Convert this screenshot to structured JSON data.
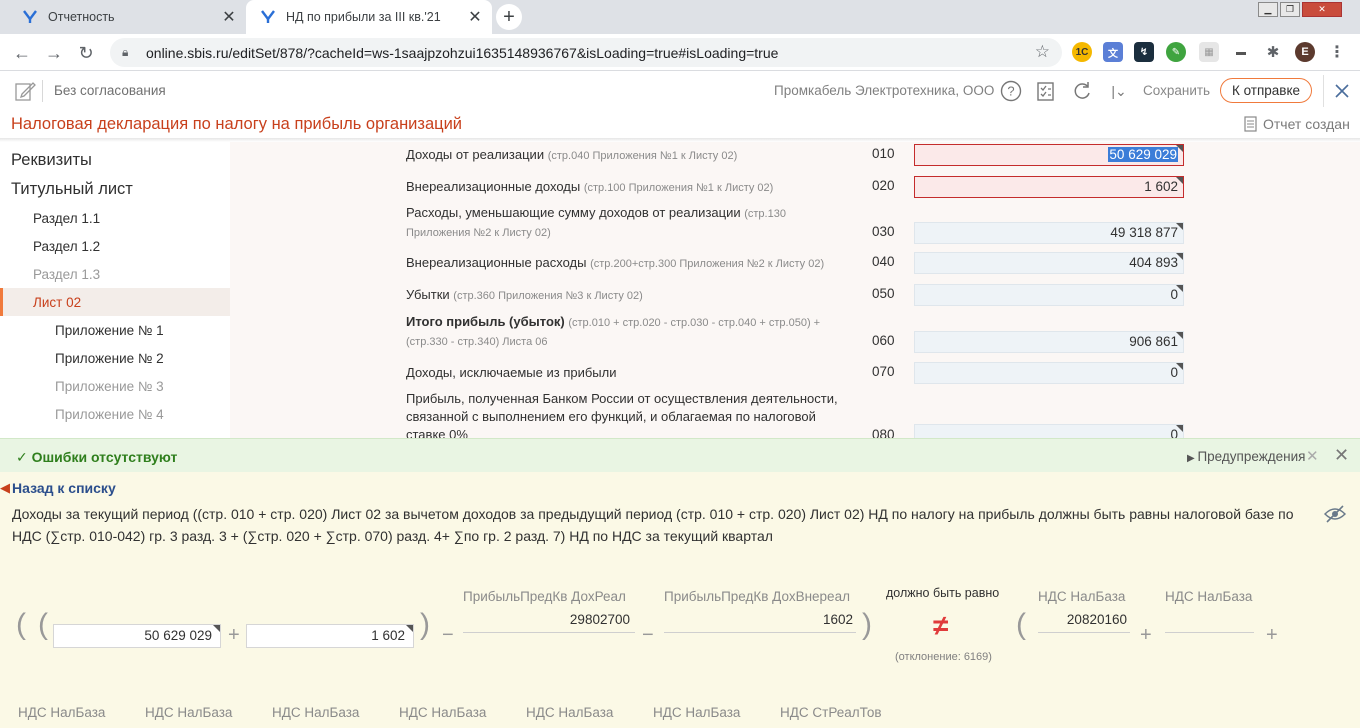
{
  "browser": {
    "tabs": [
      {
        "title": "Отчетность"
      },
      {
        "title": "НД по прибыли за III кв.'21"
      }
    ],
    "new_tab": "+",
    "url": "online.sbis.ru/editSet/878/?cacheId=ws-1saajpzohzui1635148936767&isLoading=true#isLoading=true",
    "profile_initial": "E"
  },
  "header": {
    "approval": "Без согласования",
    "org": "Промкабель Электротехника, ООО",
    "save": "Сохранить",
    "send": "К отправке"
  },
  "document": {
    "title": "Налоговая декларация по налогу на прибыль организаций",
    "status": "Отчет создан"
  },
  "sidebar": {
    "items": [
      {
        "label": "Реквизиты"
      },
      {
        "label": "Титульный лист"
      },
      {
        "label": "Раздел 1.1"
      },
      {
        "label": "Раздел 1.2"
      },
      {
        "label": "Раздел 1.3"
      },
      {
        "label": "Лист 02"
      },
      {
        "label": "Приложение № 1"
      },
      {
        "label": "Приложение № 2"
      },
      {
        "label": "Приложение № 3"
      },
      {
        "label": "Приложение № 4"
      }
    ]
  },
  "form": {
    "rows": [
      {
        "label": "Доходы от реализации",
        "hint": "(стр.040 Приложения №1 к Листу 02)",
        "code": "010",
        "value": "50 629 029"
      },
      {
        "label": "Внереализационные доходы",
        "hint": "(стр.100 Приложения №1 к Листу 02)",
        "code": "020",
        "value": "1 602"
      },
      {
        "label": "Расходы, уменьшающие сумму доходов от реализации",
        "hint": "(стр.130 Приложения №2 к Листу 02)",
        "code": "030",
        "value": "49 318 877"
      },
      {
        "label": "Внереализационные расходы",
        "hint": "(стр.200+стр.300 Приложения №2 к Листу 02)",
        "code": "040",
        "value": "404 893"
      },
      {
        "label": "Убытки",
        "hint": "(стр.360 Приложения №3 к Листу 02)",
        "code": "050",
        "value": "0"
      },
      {
        "label": "Итого прибыль (убыток)",
        "hint": "(стр.010 + стр.020 - стр.030 - стр.040 + стр.050) + (стр.330 - стр.340) Листа 06",
        "code": "060",
        "value": "906 861"
      },
      {
        "label": "Доходы, исключаемые из прибыли",
        "hint": "",
        "code": "070",
        "value": "0"
      },
      {
        "label": "Прибыль, полученная Банком России от осуществления деятельности, связанной с выполнением его функций, и облагаемая по налоговой ставке 0%",
        "hint": "",
        "code": "080",
        "value": "0"
      }
    ]
  },
  "validation": {
    "status": "Ошибки отсутствуют",
    "warnings": "Предупреждения",
    "back": "Назад к списку",
    "description": "Доходы за текущий период ((стр. 010 + стр. 020) Лист 02 за вычетом доходов за предыдущий период (стр. 010 + стр. 020) Лист 02) НД по налогу на прибыль должны быть равны налоговой базе по НДС (∑стр. 010-042) гр. 3 разд. 3 + (∑стр. 020 + ∑стр. 070) разд. 4+ ∑по гр. 2 разд. 7) НД по НДС за текущий квартал",
    "formula": {
      "in1": "50 629 029",
      "in2": "1 602",
      "label_prev_real": "ПрибыльПредКв ДохРеал",
      "value_prev_real": "29802700",
      "label_prev_vnereal": "ПрибыльПредКв ДохВнереал",
      "value_prev_vnereal": "1602",
      "must_equal": "должно быть равно",
      "deviation": "(отклонение: 6169)",
      "label_nds1": "НДС НалБаза",
      "value_nds1": "20820160",
      "label_nds2": "НДС НалБаза",
      "value_nds2": "",
      "bottom_labels": [
        "НДС НалБаза",
        "НДС НалБаза",
        "НДС НалБаза",
        "НДС НалБаза",
        "НДС НалБаза",
        "НДС НалБаза",
        "НДС СтРеалТов"
      ]
    }
  }
}
